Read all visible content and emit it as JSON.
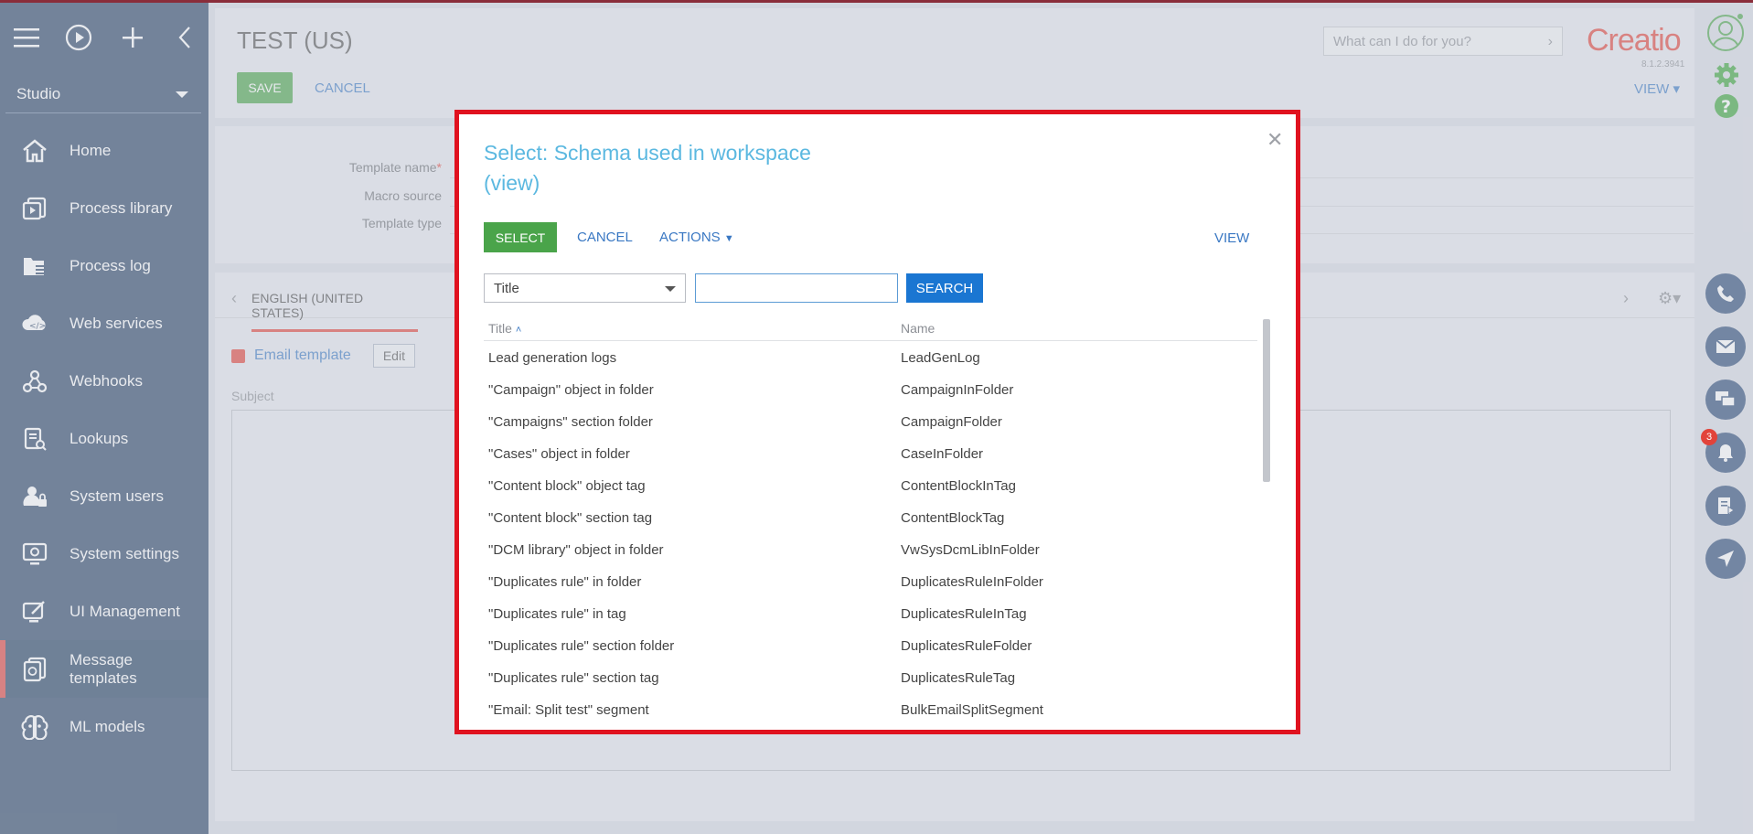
{
  "sidebar": {
    "workspace": "Studio",
    "items": [
      {
        "label": "Home",
        "icon": "home-icon"
      },
      {
        "label": "Process library",
        "icon": "process-library-icon"
      },
      {
        "label": "Process log",
        "icon": "process-log-icon"
      },
      {
        "label": "Web services",
        "icon": "cloud-icon"
      },
      {
        "label": "Webhooks",
        "icon": "webhook-icon"
      },
      {
        "label": "Lookups",
        "icon": "lookup-icon"
      },
      {
        "label": "System users",
        "icon": "users-icon"
      },
      {
        "label": "System settings",
        "icon": "settings-icon"
      },
      {
        "label": "UI Management",
        "icon": "ui-icon"
      },
      {
        "label": "Message templates",
        "icon": "templates-icon"
      },
      {
        "label": "ML models",
        "icon": "brain-icon"
      }
    ]
  },
  "header": {
    "title": "TEST (US)",
    "save_label": "SAVE",
    "cancel_label": "CANCEL",
    "search_placeholder": "What can I do for you?",
    "logo": "Creatio",
    "version": "8.1.2.3941",
    "view_label": "VIEW"
  },
  "form": {
    "template_name_label": "Template name",
    "macro_source_label": "Macro source",
    "template_type_label": "Template type"
  },
  "tabs": {
    "language": "ENGLISH (UNITED STATES)",
    "email_template_label": "Email template",
    "edit_label": "Edit",
    "subject_label": "Subject"
  },
  "rail": {
    "notification_count": "3"
  },
  "dialog": {
    "title": "Select: Schema used in workspace (view)",
    "select_label": "SELECT",
    "cancel_label": "CANCEL",
    "actions_label": "ACTIONS",
    "view_label": "VIEW",
    "filter_field": "Title",
    "search_label": "SEARCH",
    "columns": [
      "Title",
      "Name"
    ],
    "rows": [
      {
        "title": "Lead generation logs",
        "name": "LeadGenLog"
      },
      {
        "title": "\"Campaign\" object in folder",
        "name": "CampaignInFolder"
      },
      {
        "title": "\"Campaigns\" section folder",
        "name": "CampaignFolder"
      },
      {
        "title": "\"Cases\" object in folder",
        "name": "CaseInFolder"
      },
      {
        "title": "\"Content block\" object tag",
        "name": "ContentBlockInTag"
      },
      {
        "title": "\"Content block\" section tag",
        "name": "ContentBlockTag"
      },
      {
        "title": "\"DCM library\" object in folder",
        "name": "VwSysDcmLibInFolder"
      },
      {
        "title": "\"Duplicates rule\" in folder",
        "name": "DuplicatesRuleInFolder"
      },
      {
        "title": "\"Duplicates rule\" in tag",
        "name": "DuplicatesRuleInTag"
      },
      {
        "title": "\"Duplicates rule\" section folder",
        "name": "DuplicatesRuleFolder"
      },
      {
        "title": "\"Duplicates rule\" section tag",
        "name": "DuplicatesRuleTag"
      },
      {
        "title": "\"Email: Split test\" segment",
        "name": "BulkEmailSplitSegment"
      }
    ]
  }
}
